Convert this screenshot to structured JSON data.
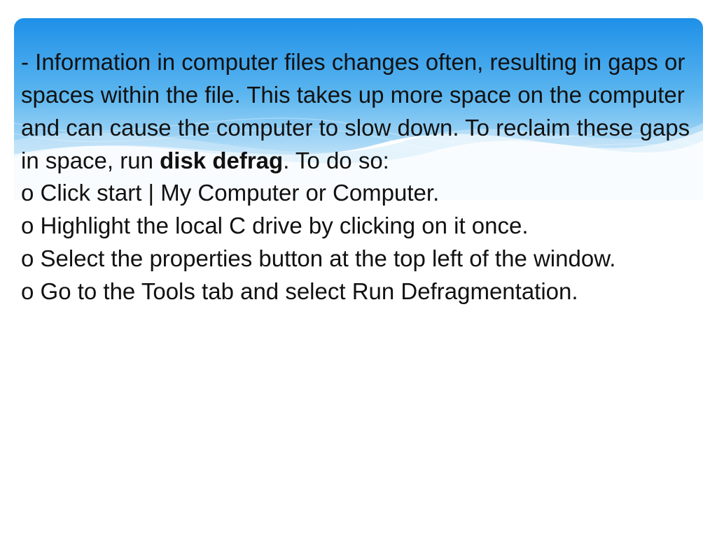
{
  "intro": {
    "lead": "- Information in computer files changes often, resulting in gaps or spaces within the file. This takes up more space on the computer and can cause the computer to slow down. To reclaim these gaps in space, run ",
    "bold": "disk defrag",
    "tail": ". To do so:"
  },
  "steps": [
    "o Click start | My Computer or Computer.",
    "o Highlight the local C drive by clicking on it once.",
    "o Select the properties button at the top left of the window.",
    "o Go to the Tools tab and select Run Defragmentation."
  ],
  "colors": {
    "grad_top": "#1e90e8",
    "grad_mid": "#4fb0ee",
    "grad_low": "#a9d8f6",
    "grad_fade": "#ffffff"
  }
}
